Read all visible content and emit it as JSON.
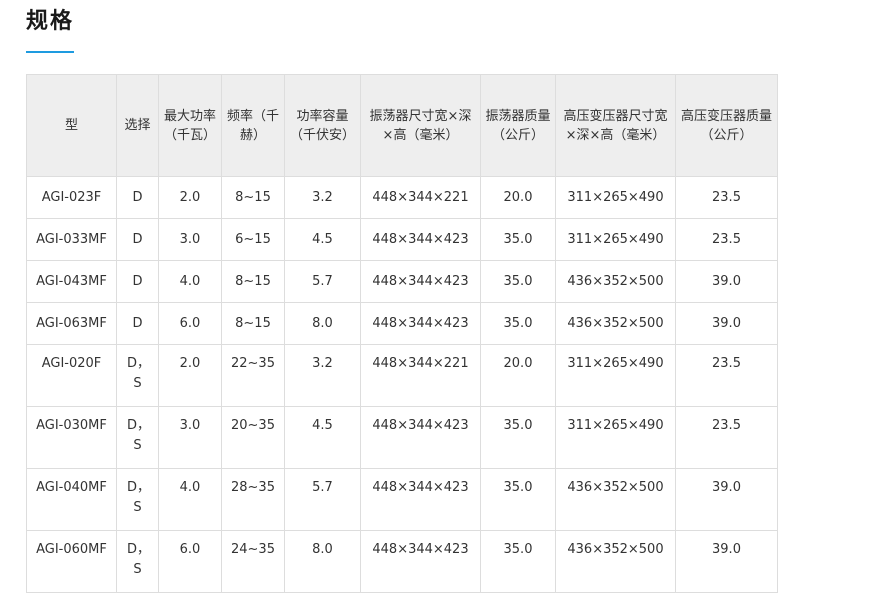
{
  "page": {
    "title": "规格"
  },
  "table": {
    "headers": [
      "型",
      "选择",
      "最大功率（千瓦）",
      "频率（千赫）",
      "功率容量（千伏安）",
      "振荡器尺寸宽×深×高（毫米）",
      "振荡器质量（公斤）",
      "高压变压器尺寸宽×深×高（毫米）",
      "高压变压器质量（公斤）"
    ],
    "rows": [
      [
        "AGI-023F",
        "D",
        "2.0",
        "8~15",
        "3.2",
        "448×344×221",
        "20.0",
        "311×265×490",
        "23.5"
      ],
      [
        "AGI-033MF",
        "D",
        "3.0",
        "6~15",
        "4.5",
        "448×344×423",
        "35.0",
        "311×265×490",
        "23.5"
      ],
      [
        "AGI-043MF",
        "D",
        "4.0",
        "8~15",
        "5.7",
        "448×344×423",
        "35.0",
        "436×352×500",
        "39.0"
      ],
      [
        "AGI-063MF",
        "D",
        "6.0",
        "8~15",
        "8.0",
        "448×344×423",
        "35.0",
        "436×352×500",
        "39.0"
      ],
      [
        "AGI-020F",
        "D，S",
        "2.0",
        "22~35",
        "3.2",
        "448×344×221",
        "20.0",
        "311×265×490",
        "23.5"
      ],
      [
        "AGI-030MF",
        "D，S",
        "3.0",
        "20~35",
        "4.5",
        "448×344×423",
        "35.0",
        "311×265×490",
        "23.5"
      ],
      [
        "AGI-040MF",
        "D，S",
        "4.0",
        "28~35",
        "5.7",
        "448×344×423",
        "35.0",
        "436×352×500",
        "39.0"
      ],
      [
        "AGI-060MF",
        "D，S",
        "6.0",
        "24~35",
        "8.0",
        "448×344×423",
        "35.0",
        "436×352×500",
        "39.0"
      ]
    ]
  }
}
